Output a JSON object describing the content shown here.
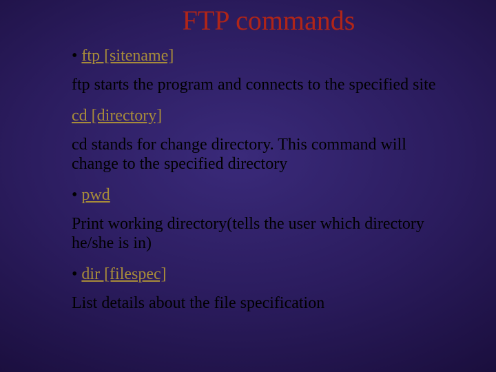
{
  "title": "FTP commands",
  "items": [
    {
      "bullet": "• ",
      "link": "ftp [sitename]",
      "desc": "ftp starts the program and connects to the specified site"
    },
    {
      "bullet": "",
      "link": "cd [directory]",
      "desc": "cd stands for change directory. This command will change to the specified directory"
    },
    {
      "bullet": "• ",
      "link": "pwd",
      "desc": "Print working directory(tells the user which directory he/she is in)"
    },
    {
      "bullet": "• ",
      "link": "dir [filespec]",
      "desc": "List details about the file specification"
    }
  ]
}
